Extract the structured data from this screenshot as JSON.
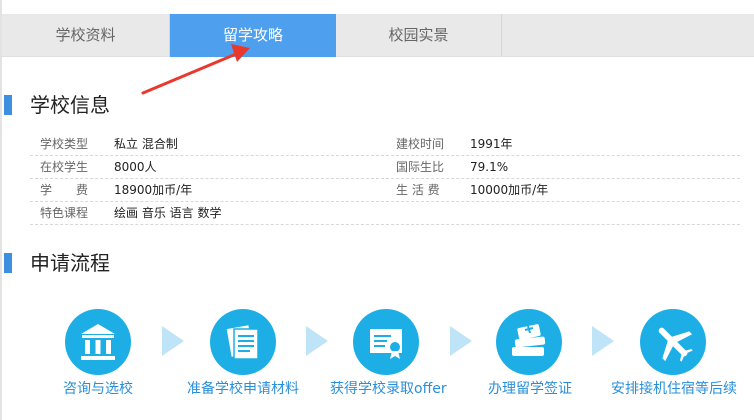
{
  "tabs": [
    {
      "label": "学校资料"
    },
    {
      "label": "留学攻略"
    },
    {
      "label": "校园实景"
    }
  ],
  "school_info": {
    "title": "学校信息",
    "rows": [
      {
        "k1": "学校类型",
        "v1": "私立 混合制",
        "k2": "建校时间",
        "v2": "1991年"
      },
      {
        "k1": "在校学生",
        "v1": "8000人",
        "k2": "国际生比",
        "v2": "79.1%"
      },
      {
        "k1": "学　　费",
        "v1": "18900加币/年",
        "k2": "生 活 费",
        "v2": "10000加币/年"
      },
      {
        "k1": "特色课程",
        "v1": "绘画 音乐 语言 数学",
        "k2": "",
        "v2": ""
      }
    ]
  },
  "process": {
    "title": "申请流程",
    "steps": [
      {
        "label": "咨询与选校",
        "icon": "school-building-icon"
      },
      {
        "label": "准备学校申请材料",
        "icon": "documents-icon"
      },
      {
        "label": "获得学校录取offer",
        "icon": "certificate-icon"
      },
      {
        "label": "办理留学签证",
        "icon": "passport-books-icon"
      },
      {
        "label": "安排接机住宿等后续",
        "icon": "airplane-icon"
      }
    ]
  },
  "colors": {
    "active_tab": "#4ea0ee",
    "step_circle": "#1eaee6",
    "step_label": "#2a8fd8",
    "pointer_arrow": "#e8392c"
  }
}
